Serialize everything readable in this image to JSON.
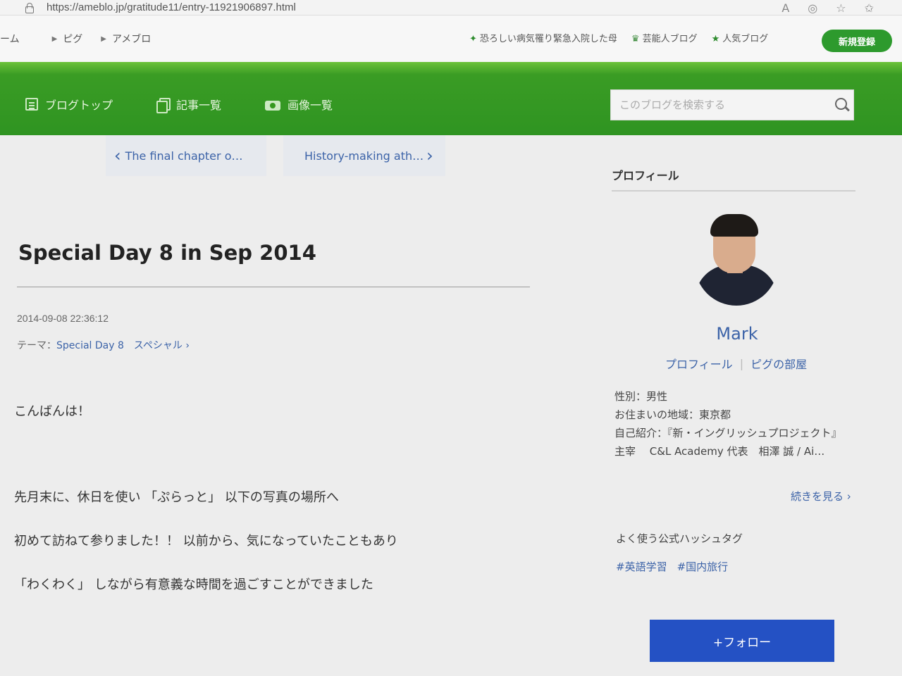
{
  "browser": {
    "url": "https://ameblo.jp/gratitude11/entry-11921906897.html"
  },
  "global_nav": {
    "crumbs": [
      "ーム",
      "ピグ",
      "アメブロ"
    ],
    "headline": "恐ろしい病気罹り緊急入院した母",
    "celebrity_blog": "芸能人ブログ",
    "popular_blog": "人気ブログ",
    "signup": "新規登録"
  },
  "blog_nav": {
    "items": [
      {
        "label": "ブログトップ",
        "icon": "document-icon"
      },
      {
        "label": "記事一覧",
        "icon": "copy-icon"
      },
      {
        "label": "画像一覧",
        "icon": "camera-icon"
      }
    ],
    "search_placeholder": "このブログを検索する"
  },
  "article": {
    "prev_link": "The final chapter o…",
    "next_link": "History-making ath…",
    "title": "Special Day 8 in Sep 2014",
    "date": "2014-09-08 22:36:12",
    "theme_label": "テーマ：",
    "theme_value": "Special Day 8　スペシャル",
    "paragraphs": [
      "こんばんは！",
      "先月末に、休日を使い 「ぷらっと」 以下の写真の場所へ",
      "初めて訪ねて参りました！！ 以前から、気になっていたこともあり",
      "「わくわく」 しながら有意義な時間を過ごすことができました"
    ]
  },
  "profile": {
    "heading": "プロフィール",
    "name": "Mark",
    "link_profile": "プロフィール",
    "link_room": "ピグの部屋",
    "gender": "性別：男性",
    "location": "お住まいの地域：東京都",
    "intro": "自己紹介：『新・イングリッシュプロジェクト』 主宰　 C&L Academy 代表　相澤 誠 / Ai…",
    "more": "続きを見る",
    "tags_heading": "よく使う公式ハッシュタグ",
    "tags": [
      "#英語学習",
      "#国内旅行"
    ],
    "follow": "+フォロー"
  },
  "colors": {
    "header_green": "#2f9422",
    "link_blue": "#3c63a8",
    "follow_blue": "#2451c4",
    "signup_green": "#2d9a2d"
  }
}
